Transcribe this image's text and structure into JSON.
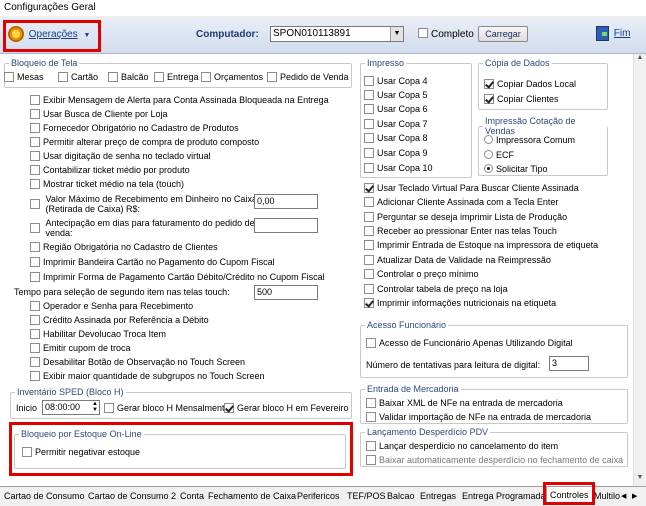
{
  "window": {
    "title": "Configurações Geral"
  },
  "toolbar": {
    "operacoes": "Operações",
    "computador_label": "Computador:",
    "computador_value": "SPON010113891",
    "completo": "Completo",
    "carregar": "Carregar",
    "fim": "Fim"
  },
  "bloqueio": {
    "legend": "Bloqueio de Tela",
    "items": [
      "Mesas",
      "Cartão",
      "Balcão",
      "Entrega",
      "Orçamentos",
      "Pedido de Venda"
    ]
  },
  "options": {
    "o1": "Exibir Mensagem de Alerta para Conta Assinada Bloqueada na Entrega",
    "o2": "Usar Busca de Cliente por Loja",
    "o3": "Fornecedor Obrigatório no Cadastro de Produtos",
    "o4": "Permitir alterar preço de compra de produto composto",
    "o5": "Usar digitação de senha no teclado virtual",
    "o6": "Contabilizar ticket médio por produto",
    "o7": "Mostrar ticket médio na tela (touch)",
    "o8a": "Valor Máximo de Recebimento em Dinheiro no Caixa",
    "o8b": "(Retirada de Caixa) R$:",
    "o8v": "0,00",
    "o9a": "Antecipação em dias para faturamento do pedido de",
    "o9b": "venda:",
    "o10": "Região Obrigatória no Cadastro de Clientes",
    "o11": "Imprimir Bandeira Cartão no Pagamento do Cupom Fiscal",
    "o12": "Imprimir Forma de Pagamento Cartão Débito/Crédito no Cupom Fiscal",
    "tempo": "Tempo para seleção de segundo item nas telas touch:",
    "tempo_v": "500",
    "o13": "Operador e Senha para Recebimento",
    "o14": "Crédito Assinada por Referência a Débito",
    "o15": "Habilitar Devolucao Troca Item",
    "o16": "Emitir cupom de troca",
    "o17": "Desabilitar Botão de Observação no Touch Screen",
    "o18": "Exibir maior quantidade de subgrupos no Touch Screen"
  },
  "sped": {
    "legend": "Inventário SPED (Bloco H)",
    "inicio": "Inicio",
    "hora": "08:00:00",
    "mensal": "Gerar bloco H Mensalmente",
    "fev": "Gerar bloco H em Fevereiro"
  },
  "estoque": {
    "legend": "Bloqueio por Estoque On-Line",
    "neg": "Permitir negativar estoque"
  },
  "impresso": {
    "legend": "Impresso",
    "copas": [
      "Usar Copa 4",
      "Usar Copa 5",
      "Usar Copa 6",
      "Usar Copa 7",
      "Usar Copa 8",
      "Usar Copa 9",
      "Usar Copa 10"
    ]
  },
  "copia": {
    "legend": "Cópia de Dados",
    "local": "Copiar Dados Local",
    "clientes": "Copiar Clientes"
  },
  "cotacao": {
    "legend": "Impressão Cotação de Vendas",
    "r1": "Impressora Comum",
    "r2": "ECF",
    "r3": "Solicitar Tipo"
  },
  "right": {
    "r1": "Usar Teclado Virtual Para Buscar Cliente Assinada",
    "r2": "Adicionar Cliente Assinada com a Tecla Enter",
    "r3": "Perguntar se deseja imprimir Lista de Produção",
    "r4": "Receber ao pressionar Enter nas telas Touch",
    "r5": "Imprimir Entrada de Estoque na impressora de etiqueta",
    "r6": "Atualizar Data de Validade na Reimpressão",
    "r7": "Controlar o preço mínimo",
    "r8": "Controlar tabela de preço na loja",
    "r9": "Imprimir informações nutricionais na etiqueta"
  },
  "acesso": {
    "legend": "Acesso Funcionário",
    "digital": "Acesso de Funcionário Apenas Utilizando Digital",
    "tent": "Número de tentativas para leitura de digital:",
    "tent_v": "3"
  },
  "entrada": {
    "legend": "Entrada de Mercadoria",
    "xml": "Baixar XML de NFe na entrada de mercadoria",
    "valid": "Validar importação de NFe na entrada de mercadoria"
  },
  "desperdicio": {
    "legend": "Lançamento Desperdício PDV",
    "c1": "Lançar desperdicio no cancelamento do item",
    "c2": "Baixar automaticamente desperdício no fechamento de caixa"
  },
  "tabs": [
    "Cartao de Consumo",
    "Cartao de Consumo 2",
    "Conta",
    "Fechamento de Caixa",
    "Perifericos",
    "TEF/POS",
    "Balcao",
    "Entregas",
    "Entrega Programada",
    "Controles",
    "Multiloj"
  ],
  "colors": {
    "highlight": "#e00000",
    "legend": "#2c4a7a",
    "accent": "#1a56b0"
  }
}
